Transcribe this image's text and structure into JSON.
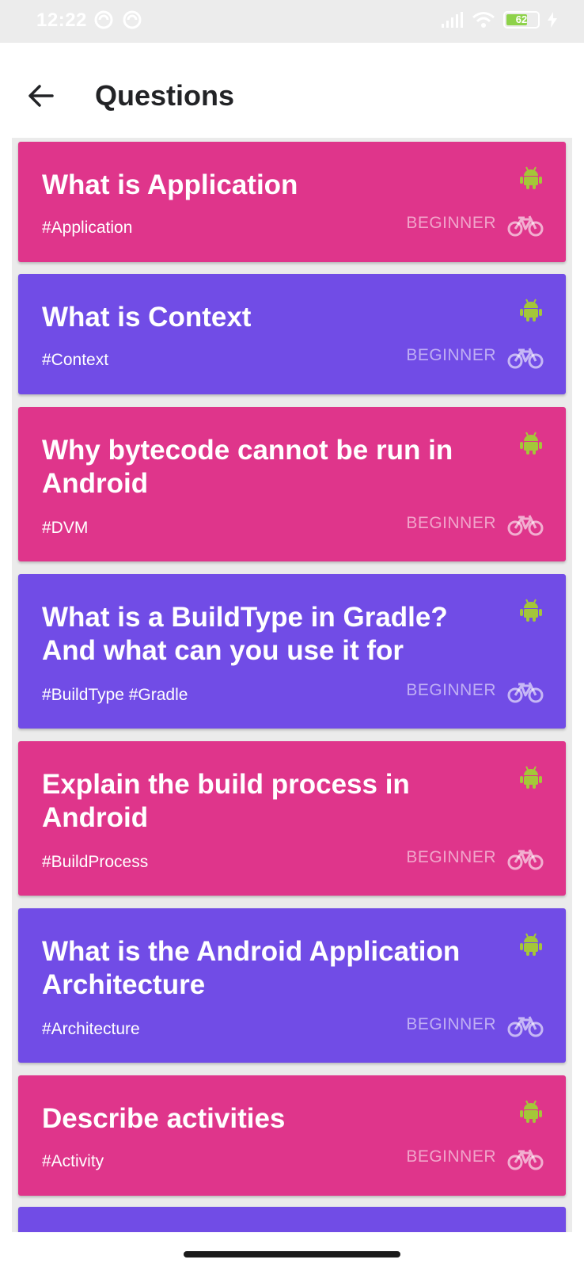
{
  "status_bar": {
    "time": "12:22",
    "battery": "62",
    "icons": [
      "notification-icon",
      "notification-icon",
      "signal-icon",
      "wifi-icon",
      "battery-icon",
      "charging-icon"
    ]
  },
  "app_bar": {
    "title": "Questions",
    "back_icon": "arrow-left-icon"
  },
  "colors": {
    "pink": "#df358b",
    "purple": "#714ce6",
    "android_green": "#a4c639",
    "background": "#ebebeb"
  },
  "questions": [
    {
      "title": "What is Application",
      "tags": "#Application",
      "level": "BEGINNER",
      "color": "pink"
    },
    {
      "title": "What is Context",
      "tags": "#Context",
      "level": "BEGINNER",
      "color": "purple"
    },
    {
      "title": "Why bytecode cannot be run in Android",
      "tags": "#DVM",
      "level": "BEGINNER",
      "color": "pink"
    },
    {
      "title": "What is a BuildType in Gradle? And what can you use it for",
      "tags": "#BuildType #Gradle",
      "level": "BEGINNER",
      "color": "purple"
    },
    {
      "title": "Explain the build process in Android",
      "tags": "#BuildProcess",
      "level": "BEGINNER",
      "color": "pink"
    },
    {
      "title": "What is the Android Application Architecture",
      "tags": "#Architecture",
      "level": "BEGINNER",
      "color": "purple"
    },
    {
      "title": "Describe activities",
      "tags": "#Activity",
      "level": "BEGINNER",
      "color": "pink"
    }
  ]
}
